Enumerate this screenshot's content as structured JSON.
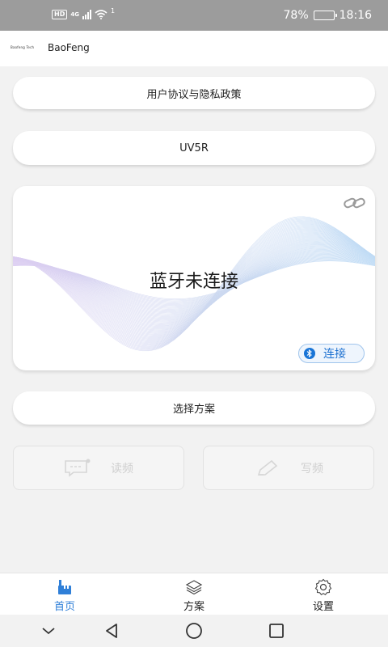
{
  "status_bar": {
    "hd": "HD",
    "network": "4G",
    "wifi_count": "1",
    "battery": "78%",
    "battery_level": 0.78,
    "time": "18:16"
  },
  "header": {
    "logo_text": "Baofeng Tech",
    "title": "BaoFeng"
  },
  "main": {
    "agreement_label": "用户协议与隐私政策",
    "model_label": "UV5R",
    "card": {
      "status": "蓝牙未连接",
      "connect_label": "连接",
      "accent": "#1874d6"
    },
    "select_scheme_label": "选择方案",
    "read_label": "读频",
    "write_label": "写频"
  },
  "bottom_nav": {
    "items": [
      {
        "label": "首页",
        "icon": "home-icon",
        "active": true
      },
      {
        "label": "方案",
        "icon": "layers-icon",
        "active": false
      },
      {
        "label": "设置",
        "icon": "gear-icon",
        "active": false
      }
    ],
    "active_color": "#2f7fd8"
  }
}
